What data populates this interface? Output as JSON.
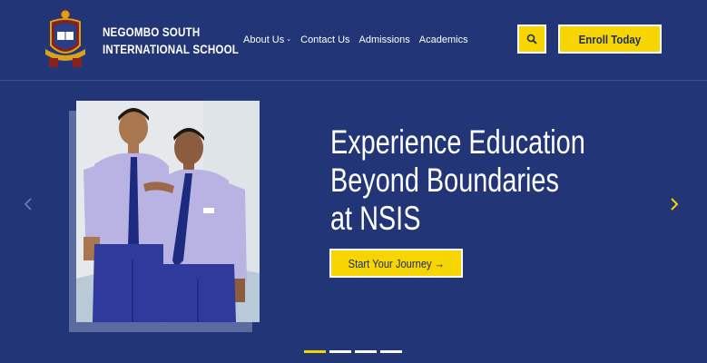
{
  "header": {
    "school_name_line1": "NEGOMBO SOUTH",
    "school_name_line2": "INTERNATIONAL SCHOOL",
    "nav": [
      {
        "label": "About Us",
        "has_dropdown": true
      },
      {
        "label": "Contact Us"
      },
      {
        "label": "Admissions"
      },
      {
        "label": "Academics"
      }
    ],
    "search_icon": "search-icon",
    "enroll_label": "Enroll Today"
  },
  "hero": {
    "title_lines": [
      "Experience Education",
      "Beyond Boundaries",
      "at NSIS"
    ],
    "cta_label": "Start Your Journey →",
    "prev_icon": "chevron-left-icon",
    "next_icon": "chevron-right-icon",
    "slides_total": 4,
    "active_slide": 1
  },
  "colors": {
    "background": "#223577",
    "accent": "#f6d500",
    "text": "#ffffff"
  }
}
